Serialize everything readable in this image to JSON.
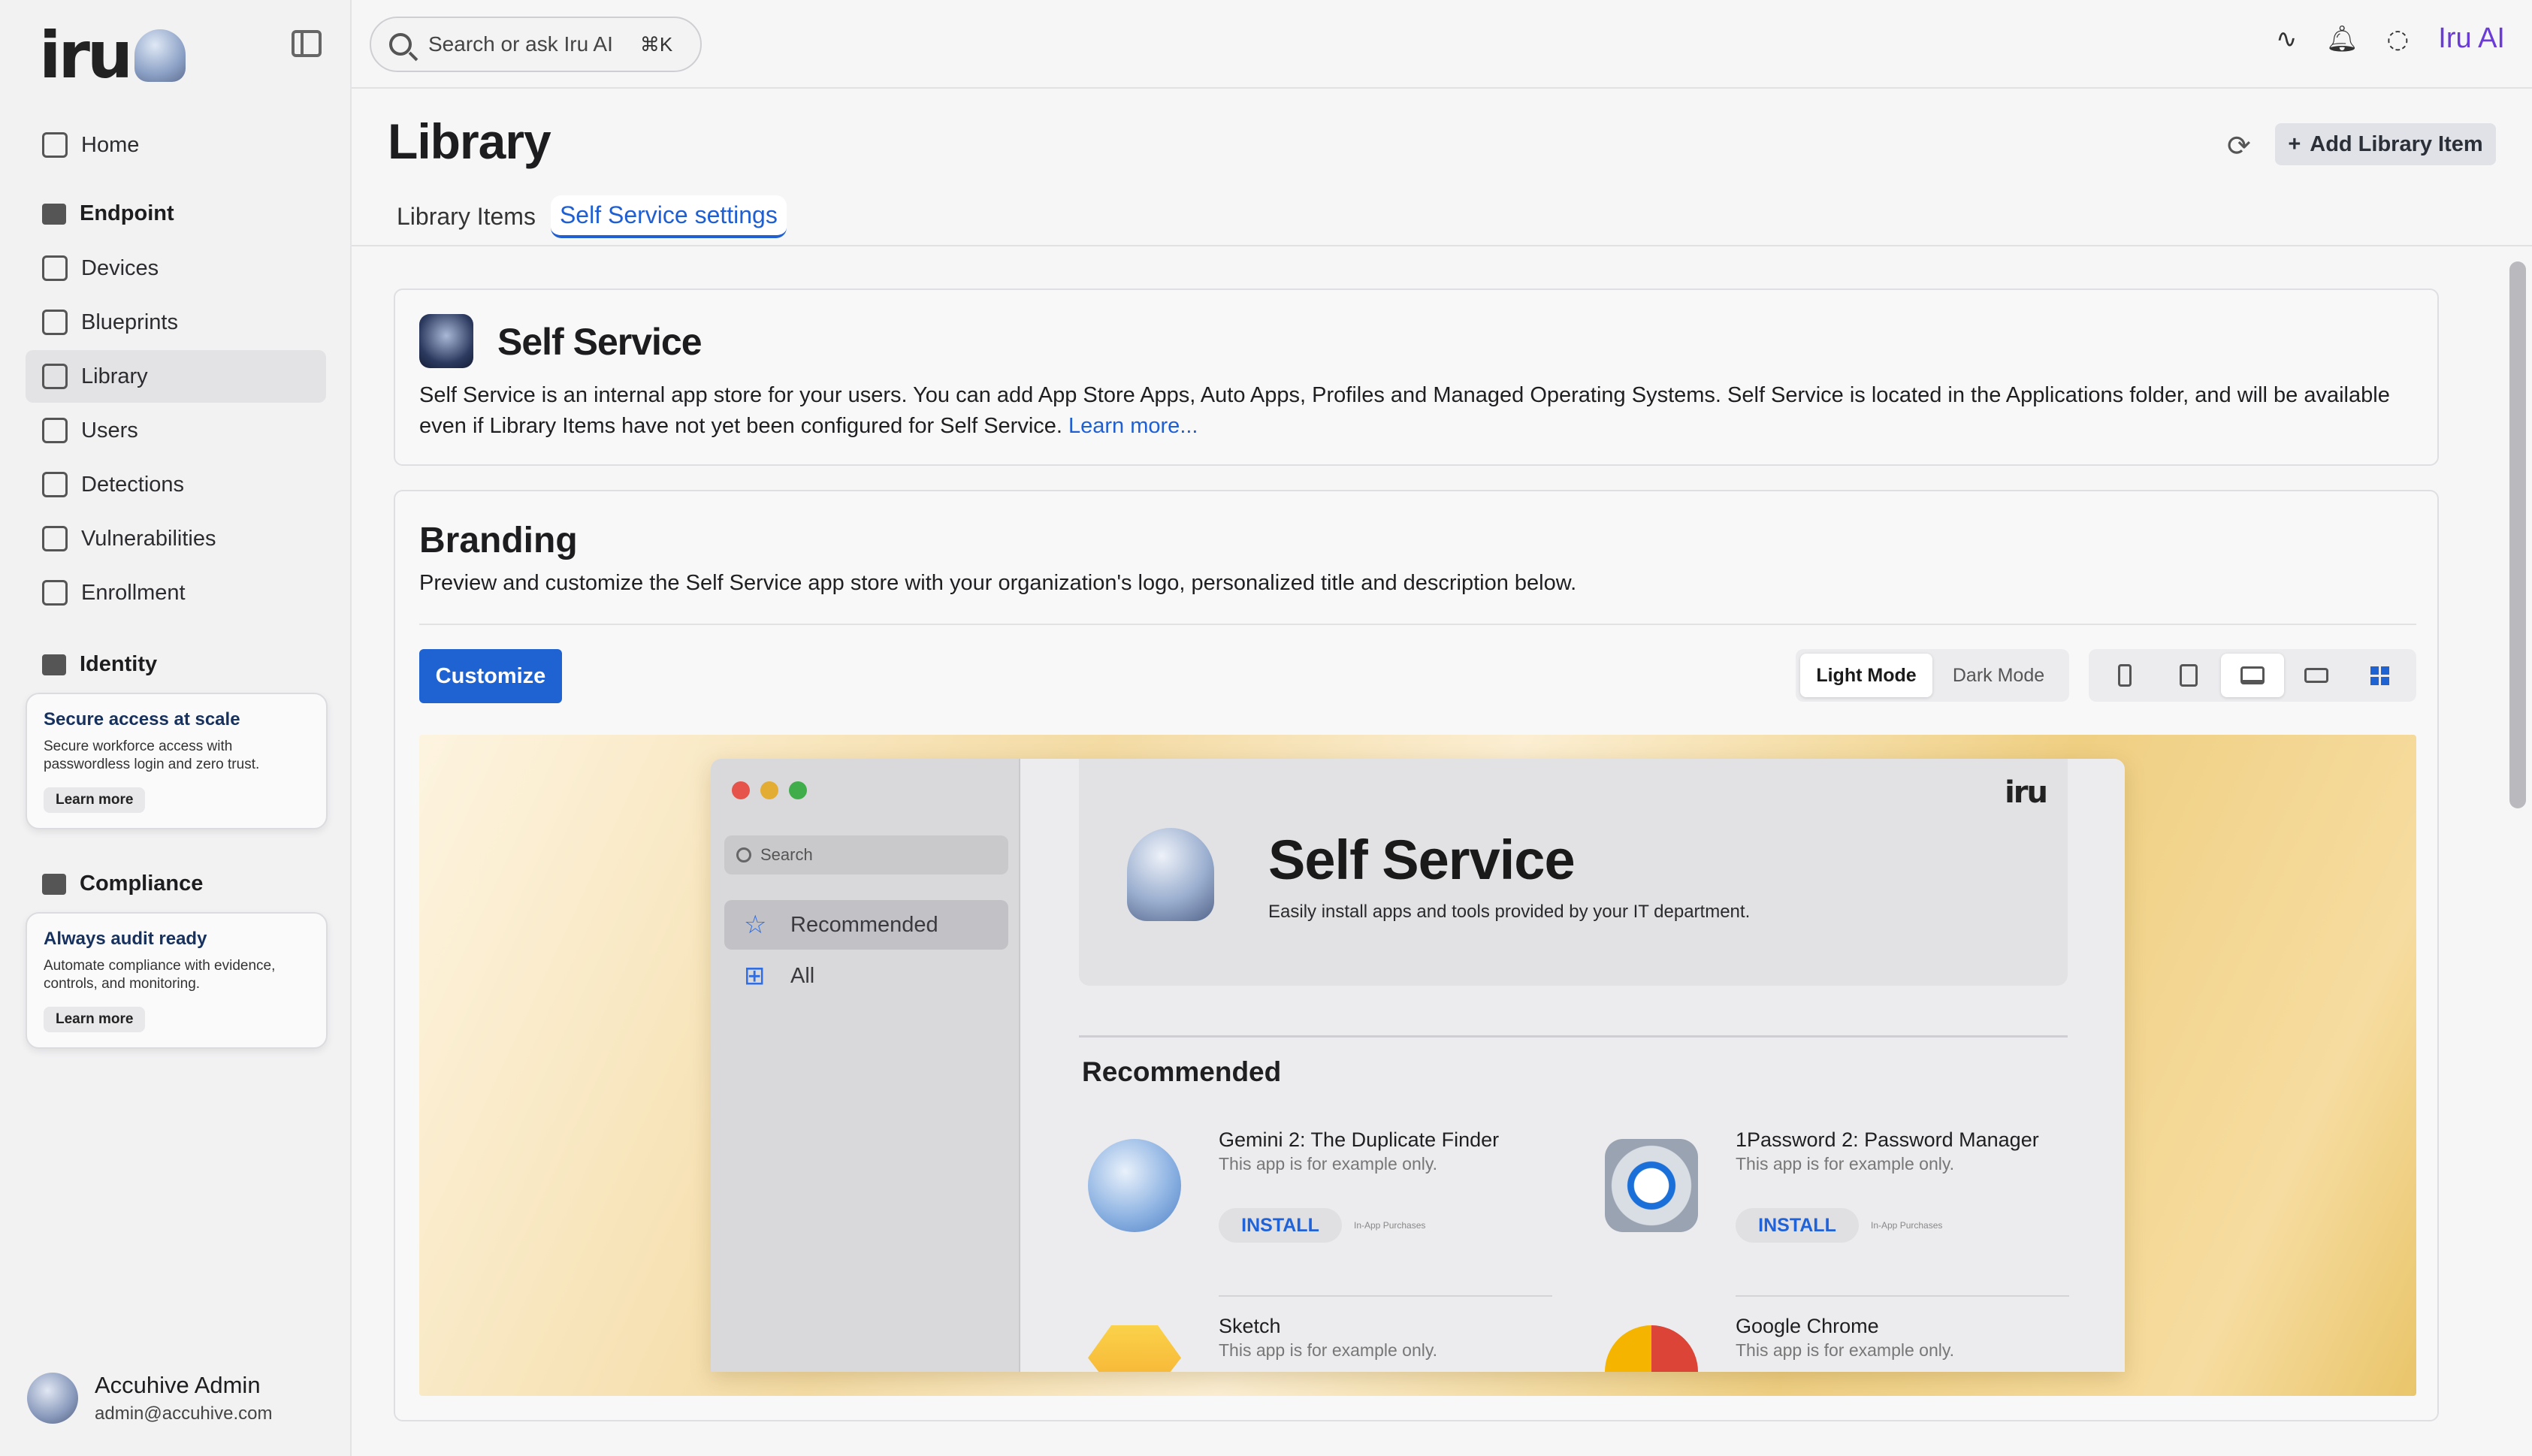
{
  "app": {
    "logo_text": "iru"
  },
  "sidebar": {
    "items": [
      {
        "label": "Home",
        "icon": "home-icon"
      },
      {
        "label": "Devices",
        "icon": "devices-icon"
      },
      {
        "label": "Blueprints",
        "icon": "blueprints-icon"
      },
      {
        "label": "Library",
        "icon": "library-icon",
        "active": true
      },
      {
        "label": "Users",
        "icon": "users-icon"
      },
      {
        "label": "Detections",
        "icon": "detections-icon"
      },
      {
        "label": "Vulnerabilities",
        "icon": "vulnerabilities-icon"
      },
      {
        "label": "Enrollment",
        "icon": "enrollment-icon"
      }
    ],
    "sections": {
      "endpoint": "Endpoint",
      "identity": "Identity",
      "compliance": "Compliance"
    },
    "promos": [
      {
        "title": "Secure access at scale",
        "text": "Secure workforce access with passwordless login and zero trust.",
        "button": "Learn more"
      },
      {
        "title": "Always audit ready",
        "text": "Automate compliance with evidence, controls, and monitoring.",
        "button": "Learn more"
      }
    ],
    "user": {
      "name": "Accuhive Admin",
      "email": "admin@accuhive.com"
    }
  },
  "topbar": {
    "search_placeholder": "Search or ask Iru AI",
    "shortcut": "⌘K",
    "ai_label": "Iru AI",
    "ai_color": "#6a3bd6"
  },
  "page": {
    "title": "Library",
    "add_button": "Add Library Item",
    "tabs": [
      {
        "label": "Library Items",
        "active": false
      },
      {
        "label": "Self Service settings",
        "active": true
      }
    ]
  },
  "self_service": {
    "title": "Self Service",
    "description": "Self Service is an internal app store for your users. You can add App Store Apps, Auto Apps, Profiles and Managed Operating Systems. Self Service is located in the Applications folder, and will be available even if Library Items have not yet been configured for Self Service.",
    "link": "Learn more..."
  },
  "branding": {
    "title": "Branding",
    "description": "Preview and customize the Self Service app store with your organization's logo, personalized title and description below.",
    "customize_button": "Customize",
    "modes": [
      {
        "label": "Light Mode",
        "active": true
      },
      {
        "label": "Dark Mode",
        "active": false
      }
    ],
    "devices": [
      {
        "name": "iphone-icon",
        "active": false
      },
      {
        "name": "ipad-icon",
        "active": false
      },
      {
        "name": "mac-icon",
        "active": true
      },
      {
        "name": "tv-icon",
        "active": false
      },
      {
        "name": "windows-icon",
        "active": false
      }
    ],
    "accent_color": "#1f63d3"
  },
  "preview": {
    "search_placeholder": "Search",
    "nav": [
      {
        "label": "Recommended",
        "selected": true
      },
      {
        "label": "All",
        "selected": false
      }
    ],
    "logo_text": "iru",
    "hero_title": "Self Service",
    "hero_subtitle": "Easily install apps and tools provided by your IT department.",
    "section_title": "Recommended",
    "apps": [
      {
        "name": "Gemini 2: The Duplicate Finder",
        "note": "This app is for example only.",
        "button": "INSTALL",
        "iap": "In-App Purchases"
      },
      {
        "name": "1Password 2: Password Manager",
        "note": "This app is for example only.",
        "button": "INSTALL",
        "iap": "In-App Purchases"
      },
      {
        "name": "Sketch",
        "note": "This app is for example only."
      },
      {
        "name": "Google Chrome",
        "note": "This app is for example only."
      }
    ]
  }
}
